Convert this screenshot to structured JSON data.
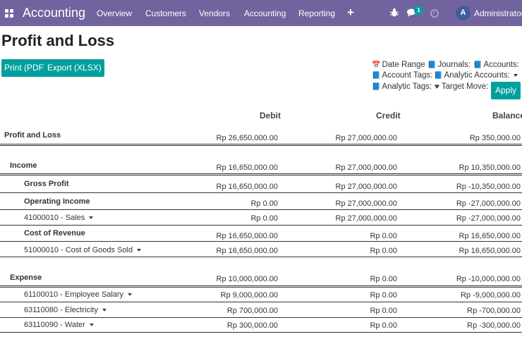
{
  "navbar": {
    "brand": "Accounting",
    "menu": [
      "Overview",
      "Customers",
      "Vendors",
      "Accounting",
      "Reporting"
    ],
    "plus": "+",
    "chat_count": "1",
    "avatar_initial": "A",
    "user_name": "Administrator ("
  },
  "page": {
    "title": "Profit and Loss",
    "print_pdf": "Print (PDF)",
    "export_xlsx": "Export (XLSX)",
    "filters": {
      "date_range": "Date Range",
      "journals": "Journals:",
      "accounts": "Accounts:",
      "account_tags": "Account Tags:",
      "analytic_accounts": "Analytic Accounts:",
      "analytic_tags": "Analytic Tags:",
      "target_move": "Target Move:"
    },
    "apply": "Apply"
  },
  "report": {
    "headers": {
      "debit": "Debit",
      "credit": "Credit",
      "balance": "Balance"
    },
    "rows": [
      {
        "name": "Profit and Loss",
        "debit": "Rp 26,650,000.00",
        "credit": "Rp 27,000,000.00",
        "balance": "Rp 350,000.00"
      },
      {
        "name": "Income",
        "debit": "Rp 16,650,000.00",
        "credit": "Rp 27,000,000.00",
        "balance": "Rp 10,350,000.00"
      },
      {
        "name": "Gross Profit",
        "debit": "Rp 16,650,000.00",
        "credit": "Rp 27,000,000.00",
        "balance": "Rp -10,350,000.00"
      },
      {
        "name": "Operating Income",
        "debit": "Rp 0.00",
        "credit": "Rp 27,000,000.00",
        "balance": "Rp -27,000,000.00"
      },
      {
        "name": "41000010 - Sales",
        "debit": "Rp 0.00",
        "credit": "Rp 27,000,000.00",
        "balance": "Rp -27,000,000.00"
      },
      {
        "name": "Cost of Revenue",
        "debit": "Rp 16,650,000.00",
        "credit": "Rp 0.00",
        "balance": "Rp 16,650,000.00"
      },
      {
        "name": "51000010 - Cost of Goods Sold",
        "debit": "Rp 16,650,000.00",
        "credit": "Rp 0.00",
        "balance": "Rp 16,650,000.00"
      },
      {
        "name": "Expense",
        "debit": "Rp 10,000,000.00",
        "credit": "Rp 0.00",
        "balance": "Rp -10,000,000.00"
      },
      {
        "name": "61100010 - Employee Salary",
        "debit": "Rp 9,000,000.00",
        "credit": "Rp 0.00",
        "balance": "Rp -9,000,000.00"
      },
      {
        "name": "63110080 - Electricity",
        "debit": "Rp 700,000.00",
        "credit": "Rp 0.00",
        "balance": "Rp -700,000.00"
      },
      {
        "name": "63110090 - Water",
        "debit": "Rp 300,000.00",
        "credit": "Rp 0.00",
        "balance": "Rp -300,000.00"
      }
    ]
  },
  "colors": {
    "navbar": "#71639e",
    "primary": "#00a09d"
  }
}
